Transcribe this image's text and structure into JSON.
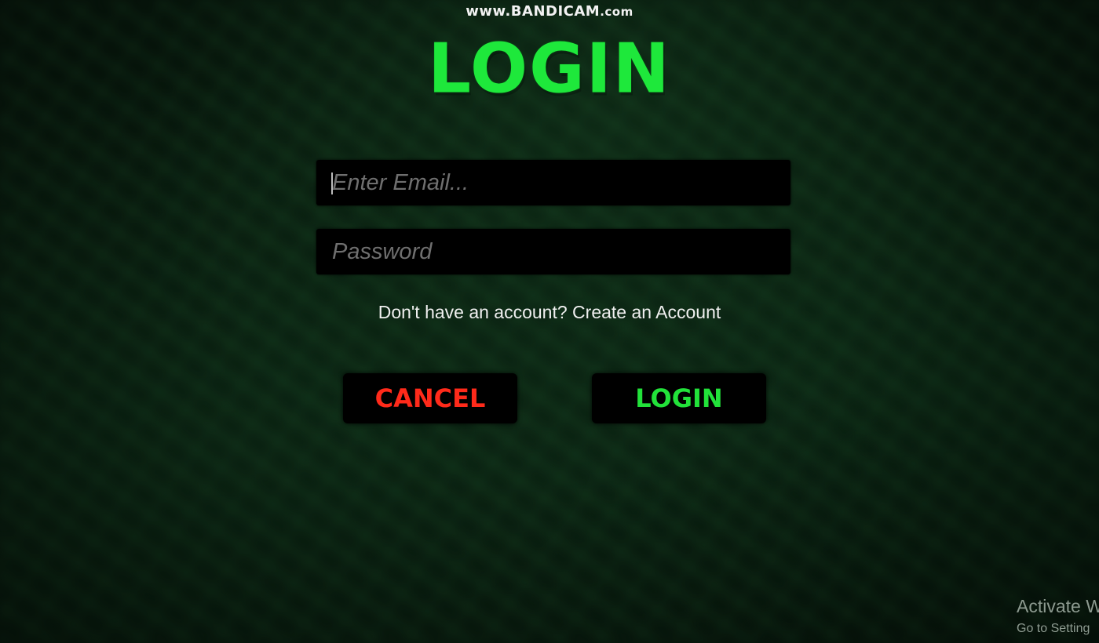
{
  "watermark": {
    "main": "www.BANDICAM",
    "suffix": ".com"
  },
  "title": "LOGIN",
  "form": {
    "email_placeholder": "Enter Email...",
    "password_placeholder": "Password"
  },
  "signup": {
    "prompt": "Don't have an account?",
    "link": "Create an Account"
  },
  "buttons": {
    "cancel": "CANCEL",
    "login": "LOGIN"
  },
  "activation": {
    "line1": "Activate W",
    "line2": "Go to Setting"
  },
  "colors": {
    "title_green": "#1ee83b",
    "cancel_red": "#ff2a1a",
    "background": "#08180d"
  }
}
